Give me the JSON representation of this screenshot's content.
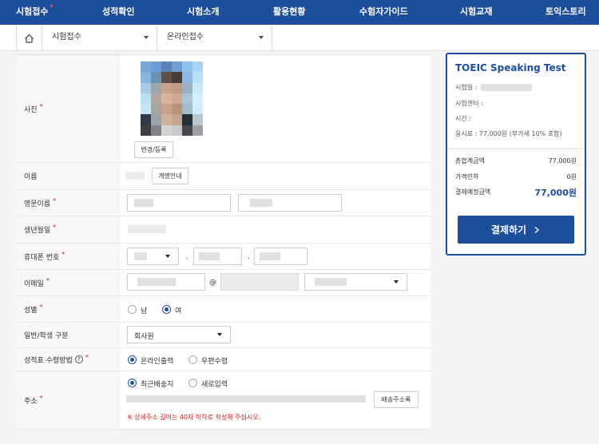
{
  "nav": {
    "items": [
      {
        "label": "시험접수"
      },
      {
        "label": "성적확인"
      },
      {
        "label": "시험소개"
      },
      {
        "label": "활용현황"
      },
      {
        "label": "수험자가이드"
      },
      {
        "label": "시험교재"
      },
      {
        "label": "토익스토리"
      }
    ]
  },
  "breadcrumb": {
    "level1": "시험접수",
    "level2": "온라인접수"
  },
  "form": {
    "photo": {
      "label": "사진",
      "button": "변경/등록"
    },
    "name": {
      "label": "이름",
      "button": "개명안내"
    },
    "english_name": {
      "label": "영문이름"
    },
    "birth": {
      "label": "생년월일"
    },
    "phone": {
      "label": "휴대폰 번호",
      "sep1": ".",
      "sep2": "."
    },
    "email": {
      "label": "이메일",
      "at": "@"
    },
    "gender": {
      "label": "성별",
      "options": [
        "남",
        "여"
      ],
      "selected": "여"
    },
    "category": {
      "label": "일반/학생 구분",
      "value": "회사원"
    },
    "report": {
      "label": "성적표 수령방법",
      "options": [
        "온라인출력",
        "우편수령"
      ],
      "selected": "온라인출력",
      "help": "?"
    },
    "address": {
      "label": "주소",
      "options": [
        "최근배송지",
        "새로입력"
      ],
      "selected": "최근배송지",
      "button": "배송주소록",
      "notice": "※ 상세주소 길이는 40자 이하로 작성해 주십시오."
    }
  },
  "summary": {
    "title": "TOEIC Speaking Test",
    "exam_date_label": "시험일 :",
    "center_label": "시험센터 :",
    "time_label": "시간 :",
    "fee_label": "응시료 : 77,000원 (부가세 10% 포함)",
    "total_label": "총합계금액",
    "total_value": "77,000원",
    "discount_label": "가격인하",
    "discount_value": "0원",
    "expected_label": "결제예정금액",
    "expected_value": "77,000원",
    "pay_button": "결제하기"
  },
  "colors": {
    "brand": "#1d4e9b",
    "required": "#d01818"
  }
}
